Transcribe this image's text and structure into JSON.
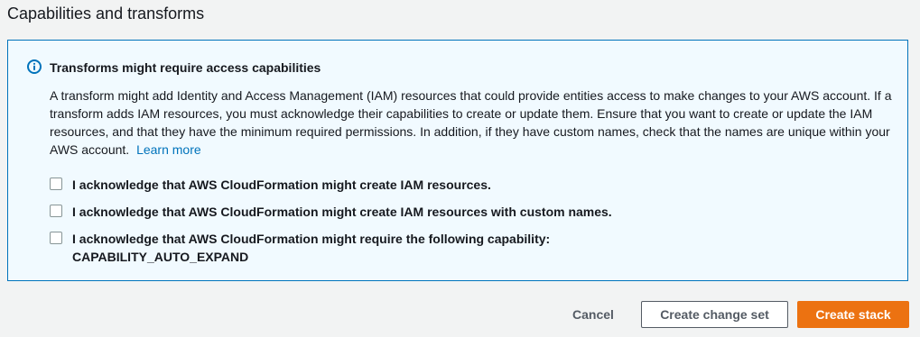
{
  "section": {
    "title": "Capabilities and transforms"
  },
  "info": {
    "icon": "info-circle-icon",
    "heading": "Transforms might require access capabilities",
    "body_text": "A transform might add Identity and Access Management (IAM) resources that could provide entities access to make changes to your AWS account. If a transform adds IAM resources, you must acknowledge their capabilities to create or update them. Ensure that you want to create or update the IAM resources, and that they have the minimum required permissions. In addition, if they have custom names, check that the names are unique within your AWS account.",
    "learn_more": "Learn more",
    "accent_color": "#0073bb"
  },
  "acknowledgements": [
    {
      "label": "I acknowledge that AWS CloudFormation might create IAM resources.",
      "checked": false
    },
    {
      "label": "I acknowledge that AWS CloudFormation might create IAM resources with custom names.",
      "checked": false
    },
    {
      "label": "I acknowledge that AWS CloudFormation might require the following capability:",
      "label_line2": "CAPABILITY_AUTO_EXPAND",
      "checked": false
    }
  ],
  "actions": {
    "cancel": "Cancel",
    "create_change_set": "Create change set",
    "create_stack": "Create stack",
    "primary_color": "#ec7211"
  }
}
